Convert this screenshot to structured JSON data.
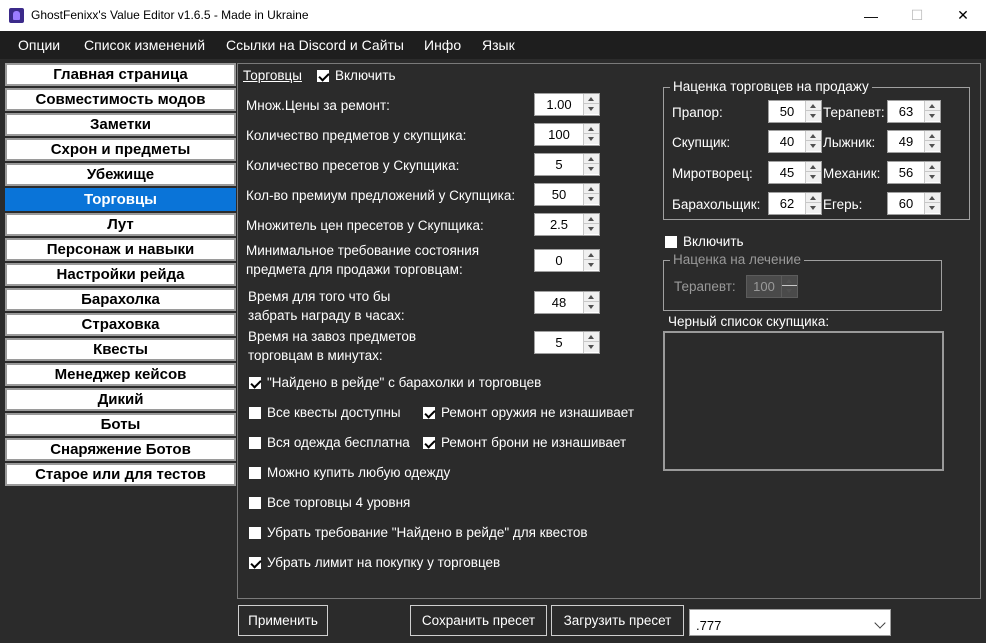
{
  "window": {
    "title": "GhostFenixx's Value Editor v1.6.5 - Made in Ukraine",
    "minimize": "—",
    "maximize": "☐",
    "close": "✕"
  },
  "menu": [
    "Опции",
    "Список изменений",
    "Ссылки на Discord и Сайты",
    "Инфо",
    "Язык"
  ],
  "sidebar": {
    "active_index": 5,
    "items": [
      "Главная страница",
      "Совместимость модов",
      "Заметки",
      "Схрон и предметы",
      "Убежище",
      "Торговцы",
      "Лут",
      "Персонаж и навыки",
      "Настройки рейда",
      "Барахолка",
      "Страховка",
      "Квесты",
      "Менеджер кейсов",
      "Дикий",
      "Боты",
      "Снаряжение Ботов",
      "Старое или для тестов"
    ]
  },
  "traders": {
    "section_title": "Торговцы",
    "enable_label": "Включить",
    "enable_checked": true,
    "settings": [
      {
        "label": "Множ.Цены за ремонт:",
        "value": "1.00"
      },
      {
        "label": "Количество предметов у скупщика:",
        "value": "100"
      },
      {
        "label": "Количество пресетов у Скупщика:",
        "value": "5"
      },
      {
        "label": "Кол-во премиум предложений у Скупщика:",
        "value": "50"
      },
      {
        "label": "Множитель цен пресетов у Скупщика:",
        "value": "2.5"
      },
      {
        "label": "Минимальное требование состояния",
        "label2": "предмета для продажи торговцам:",
        "value": "0"
      },
      {
        "label": "Время для того что бы",
        "label2": "забрать награду в часах:",
        "value": "48"
      },
      {
        "label": "Время на завоз предметов",
        "label2": "торговцам в минутах:",
        "value": "5"
      }
    ],
    "checkboxes": [
      {
        "label": "\"Найдено в рейде\" с барахолки и торговцев",
        "checked": true
      },
      {
        "label": "Все квесты доступны",
        "checked": false
      },
      {
        "label": "Ремонт оружия не изнашивает",
        "checked": true
      },
      {
        "label": "Вся одежда бесплатна",
        "checked": false
      },
      {
        "label": "Ремонт брони не изнашивает",
        "checked": true
      },
      {
        "label": "Можно купить любую одежду",
        "checked": false
      },
      {
        "label": "Все торговцы 4 уровня",
        "checked": false
      },
      {
        "label": "Убрать требование \"Найдено в рейде\" для квестов",
        "checked": false
      },
      {
        "label": "Убрать лимит на покупку у торговцев",
        "checked": true
      }
    ]
  },
  "markup_sell": {
    "title": "Наценка торговцев на продажу",
    "traders": [
      {
        "name": "Прапор:",
        "value": "50"
      },
      {
        "name": "Терапевт:",
        "value": "63"
      },
      {
        "name": "Скупщик:",
        "value": "40"
      },
      {
        "name": "Лыжник:",
        "value": "49"
      },
      {
        "name": "Миротворец:",
        "value": "45"
      },
      {
        "name": "Механик:",
        "value": "56"
      },
      {
        "name": "Барахольщик:",
        "value": "62"
      },
      {
        "name": "Егерь:",
        "value": "60"
      }
    ]
  },
  "heal_markup": {
    "enable_label": "Включить",
    "enable_checked": false,
    "title": "Наценка на лечение",
    "therapist_label": "Терапевт:",
    "therapist_value": "100"
  },
  "blacklist": {
    "title": "Черный список скупщика:"
  },
  "footer": {
    "apply": "Применить",
    "save_preset": "Сохранить пресет",
    "load_preset": "Загрузить пресет",
    "preset_value": ".777"
  }
}
